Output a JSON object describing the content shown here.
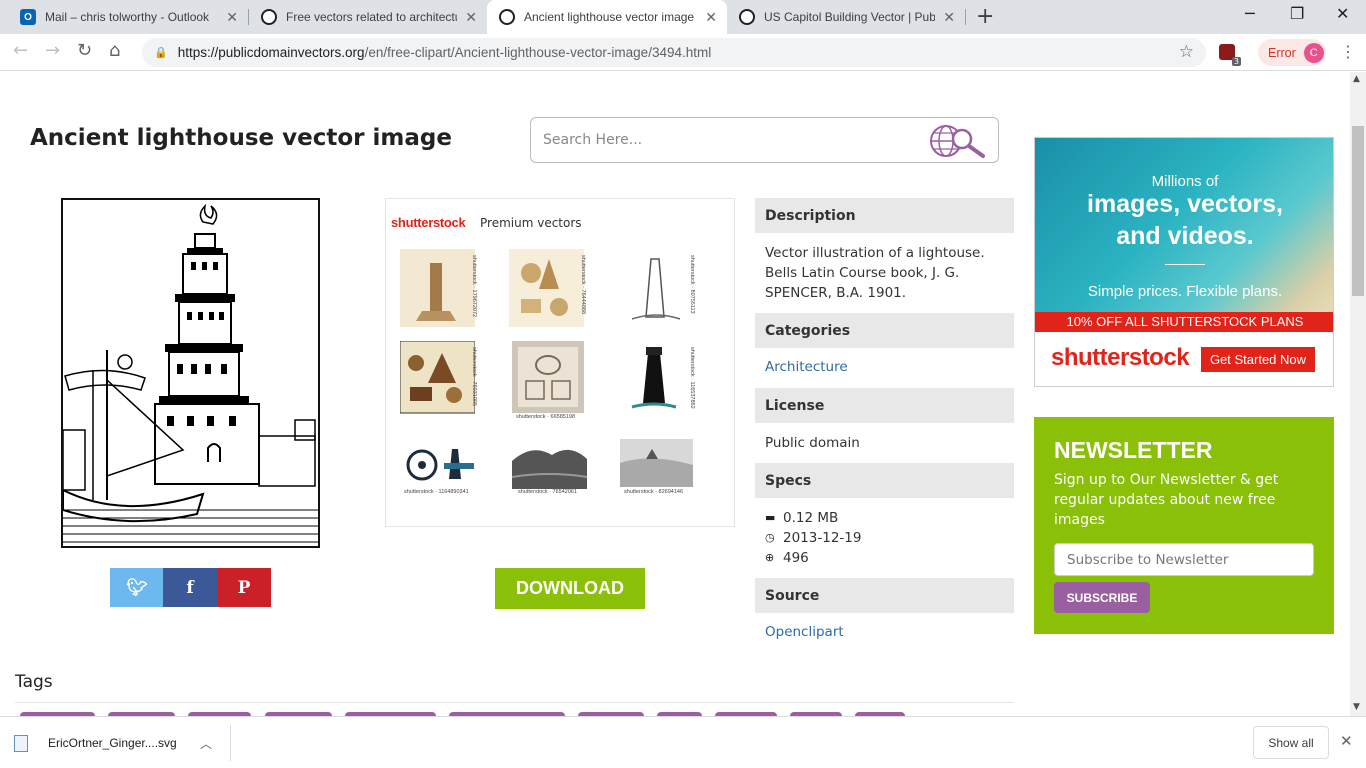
{
  "browser": {
    "tabs": [
      {
        "title": "Mail – chris tolworthy - Outlook",
        "icon": "outlook-icon"
      },
      {
        "title": "Free vectors related to architectu",
        "icon": "pdv-icon"
      },
      {
        "title": "Ancient lighthouse vector image",
        "icon": "pdv-icon",
        "active": true
      },
      {
        "title": "US Capitol Building Vector | Publ",
        "icon": "pdv-icon"
      }
    ],
    "url_host": "https://publicdomainvectors.org",
    "url_path": "/en/free-clipart/Ancient-lighthouse-vector-image/3494.html",
    "extension_badge": "3",
    "error_label": "Error",
    "profile_initial": "C"
  },
  "page": {
    "title": "Ancient lighthouse vector image",
    "search_placeholder": "Search Here...",
    "download_label": "DOWNLOAD",
    "shutterstock": {
      "logo": "shutterstock",
      "premium_label": "Premium vectors",
      "captions": [
        "shutterstock · 179672072",
        "shutterstock · 76444888",
        "shutterstock · 80755113",
        "shutterstock · 76931005",
        "shutterstock · 66585198",
        "shutterstock · 116537862",
        "shutterstock · 1164890341",
        "shutterstock · 76542061",
        "shutterstock · 82694146"
      ]
    },
    "info": {
      "description_head": "Description",
      "description": "Vector illustration of a lightouse. Bells Latin Course book, J. G. SPENCER, B.A. 1901.",
      "categories_head": "Categories",
      "category": "Architecture",
      "license_head": "License",
      "license": "Public domain",
      "specs_head": "Specs",
      "size": "0.12 MB",
      "date": "2013-12-19",
      "downloads": "496",
      "source_head": "Source",
      "source": "Openclipart"
    },
    "tags_head": "Tags",
    "ad": {
      "line1": "Millions of",
      "line2": "images, vectors,",
      "line3": "and videos.",
      "line4": "Simple prices. Flexible plans.",
      "banner": "10% OFF ALL SHUTTERSTOCK PLANS",
      "logo": "shutterstock",
      "cta": "Get Started Now"
    },
    "newsletter": {
      "heading": "NEWSLETTER",
      "description": "Sign up to Our Newsletter & get regular updates about new free images",
      "placeholder": "Subscribe to Newsletter",
      "button": "SUBSCRIBE"
    },
    "colors": {
      "accent_green": "#8ac007",
      "purple": "#9a5fa0",
      "link_blue": "#2f6aa6",
      "twitter": "#55acee",
      "facebook": "#3b5998",
      "pinterest": "#cb2027"
    }
  },
  "downloads_shelf": {
    "file": "EricOrtner_Ginger....svg",
    "show_all": "Show all"
  }
}
